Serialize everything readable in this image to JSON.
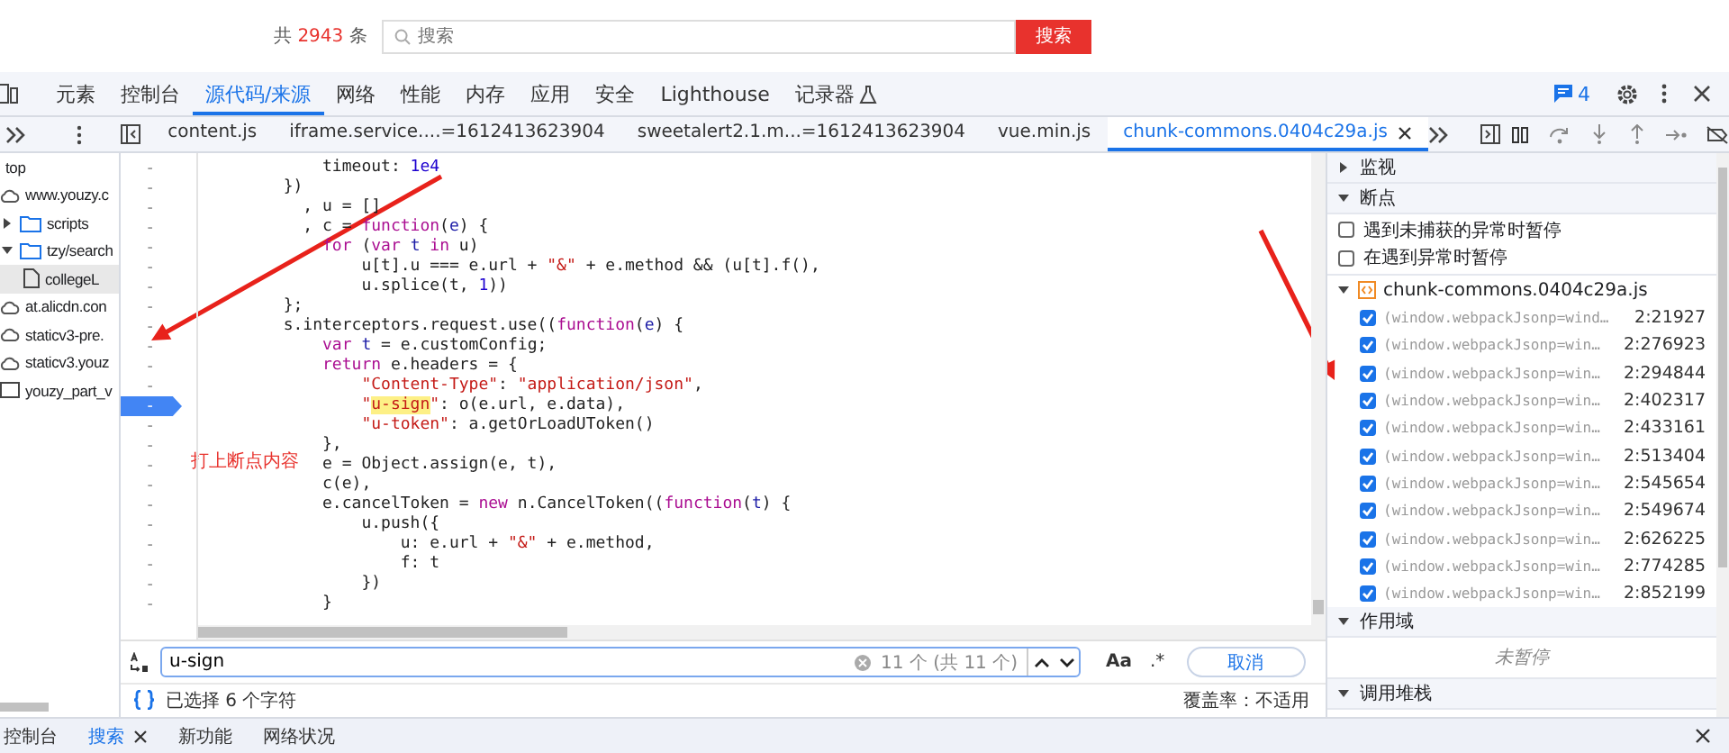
{
  "page": {
    "result_count": {
      "prefix": "共",
      "value": "2943",
      "suffix": "条"
    },
    "search": {
      "placeholder": "搜索"
    },
    "search_button": "搜索"
  },
  "devtools": {
    "tabs": [
      {
        "label": "元素",
        "selected": false,
        "experimental": false
      },
      {
        "label": "控制台",
        "selected": false,
        "experimental": false
      },
      {
        "label": "源代码/来源",
        "selected": true,
        "experimental": false
      },
      {
        "label": "网络",
        "selected": false,
        "experimental": false
      },
      {
        "label": "性能",
        "selected": false,
        "experimental": false
      },
      {
        "label": "内存",
        "selected": false,
        "experimental": false
      },
      {
        "label": "应用",
        "selected": false,
        "experimental": false
      },
      {
        "label": "安全",
        "selected": false,
        "experimental": false
      },
      {
        "label": "Lighthouse",
        "selected": false,
        "experimental": false
      },
      {
        "label": "记录器",
        "selected": false,
        "experimental": true
      }
    ],
    "issues": "4"
  },
  "sources": {
    "file_tabs": [
      {
        "label": "content.js",
        "selected": false
      },
      {
        "label": "iframe.service....=1612413623904",
        "selected": false
      },
      {
        "label": "sweetalert2.1.m...=1612413623904",
        "selected": false
      },
      {
        "label": "vue.min.js",
        "selected": false
      },
      {
        "label": "chunk-commons.0404c29a.js",
        "selected": true
      }
    ],
    "navigator": [
      {
        "label": "top",
        "selected": false,
        "children": [
          {
            "label": "www.youzy.c",
            "kind": "domain",
            "selected": false,
            "children": [
              {
                "label": "scripts",
                "kind": "folder",
                "expanded": false,
                "selected": false
              },
              {
                "label": "tzy/search",
                "kind": "folder",
                "expanded": true,
                "selected": false,
                "children": [
                  {
                    "label": "collegeL",
                    "kind": "file",
                    "selected": true
                  }
                ]
              }
            ]
          },
          {
            "label": "at.alicdn.con",
            "kind": "domain",
            "selected": false
          },
          {
            "label": "staticv3-pre.",
            "kind": "domain",
            "selected": false
          },
          {
            "label": "staticv3.youz",
            "kind": "domain",
            "selected": false
          },
          {
            "label": "youzy_part_v",
            "kind": "frame",
            "selected": false
          }
        ]
      }
    ],
    "code_lines": [
      {
        "gutter": "-",
        "breakpoint": false,
        "tokens": [
          {
            "text": "            timeout: ",
            "kind": "plain"
          },
          {
            "text": "1e4",
            "kind": "number"
          }
        ]
      },
      {
        "gutter": "-",
        "breakpoint": false,
        "tokens": [
          {
            "text": "        })",
            "kind": "plain"
          }
        ]
      },
      {
        "gutter": "-",
        "breakpoint": false,
        "tokens": [
          {
            "text": "          , u = []",
            "kind": "plain"
          }
        ]
      },
      {
        "gutter": "-",
        "breakpoint": false,
        "tokens": [
          {
            "text": "          , c = ",
            "kind": "plain"
          },
          {
            "text": "function",
            "kind": "keyword"
          },
          {
            "text": "(",
            "kind": "plain"
          },
          {
            "text": "e",
            "kind": "param"
          },
          {
            "text": ") {",
            "kind": "plain"
          }
        ]
      },
      {
        "gutter": "-",
        "breakpoint": false,
        "tokens": [
          {
            "text": "            for",
            "kind": "keyword"
          },
          {
            "text": " (",
            "kind": "plain"
          },
          {
            "text": "var ",
            "kind": "keyword"
          },
          {
            "text": "t ",
            "kind": "param"
          },
          {
            "text": "in",
            "kind": "keyword"
          },
          {
            "text": " u)",
            "kind": "plain"
          }
        ]
      },
      {
        "gutter": "-",
        "breakpoint": false,
        "tokens": [
          {
            "text": "                u[t].u === e.url + ",
            "kind": "plain"
          },
          {
            "text": "\"&\"",
            "kind": "string"
          },
          {
            "text": " + e.method && (u[t].f(),",
            "kind": "plain"
          }
        ]
      },
      {
        "gutter": "-",
        "breakpoint": false,
        "tokens": [
          {
            "text": "                u.splice(t, ",
            "kind": "plain"
          },
          {
            "text": "1",
            "kind": "number"
          },
          {
            "text": "))",
            "kind": "plain"
          }
        ]
      },
      {
        "gutter": "-",
        "breakpoint": false,
        "tokens": [
          {
            "text": "        };",
            "kind": "plain"
          }
        ]
      },
      {
        "gutter": "-",
        "breakpoint": false,
        "tokens": [
          {
            "text": "        s.interceptors.request.use((",
            "kind": "plain"
          },
          {
            "text": "function",
            "kind": "keyword"
          },
          {
            "text": "(",
            "kind": "plain"
          },
          {
            "text": "e",
            "kind": "param"
          },
          {
            "text": ") {",
            "kind": "plain"
          }
        ]
      },
      {
        "gutter": "-",
        "breakpoint": false,
        "tokens": [
          {
            "text": "            var ",
            "kind": "keyword"
          },
          {
            "text": "t",
            "kind": "param"
          },
          {
            "text": " = e.customConfig;",
            "kind": "plain"
          }
        ]
      },
      {
        "gutter": "-",
        "breakpoint": false,
        "tokens": [
          {
            "text": "            return",
            "kind": "keyword"
          },
          {
            "text": " e.headers = {",
            "kind": "plain"
          }
        ]
      },
      {
        "gutter": "-",
        "breakpoint": false,
        "tokens": [
          {
            "text": "                \"Content-Type\"",
            "kind": "string"
          },
          {
            "text": ": ",
            "kind": "plain"
          },
          {
            "text": "\"application/json\"",
            "kind": "string"
          },
          {
            "text": ",",
            "kind": "plain"
          }
        ]
      },
      {
        "gutter": "-",
        "breakpoint": true,
        "tokens": [
          {
            "text": "                \"",
            "kind": "string"
          },
          {
            "text": "u-sign",
            "kind": "match"
          },
          {
            "text": "\"",
            "kind": "string"
          },
          {
            "text": ": o(e.url, e.data),",
            "kind": "plain"
          }
        ]
      },
      {
        "gutter": "-",
        "breakpoint": false,
        "tokens": [
          {
            "text": "                \"u-token\"",
            "kind": "string"
          },
          {
            "text": ": a.getOrLoadUToken()",
            "kind": "plain"
          }
        ]
      },
      {
        "gutter": "-",
        "breakpoint": false,
        "tokens": [
          {
            "text": "            },",
            "kind": "plain"
          }
        ]
      },
      {
        "gutter": "-",
        "breakpoint": false,
        "tokens": [
          {
            "text": "            e = Object.assign(e, t),",
            "kind": "plain"
          }
        ]
      },
      {
        "gutter": "-",
        "breakpoint": false,
        "tokens": [
          {
            "text": "            c(e),",
            "kind": "plain"
          }
        ]
      },
      {
        "gutter": "-",
        "breakpoint": false,
        "tokens": [
          {
            "text": "            e.cancelToken = ",
            "kind": "plain"
          },
          {
            "text": "new",
            "kind": "keyword"
          },
          {
            "text": " n.CancelToken((",
            "kind": "plain"
          },
          {
            "text": "function",
            "kind": "keyword"
          },
          {
            "text": "(",
            "kind": "plain"
          },
          {
            "text": "t",
            "kind": "param"
          },
          {
            "text": ") {",
            "kind": "plain"
          }
        ]
      },
      {
        "gutter": "-",
        "breakpoint": false,
        "tokens": [
          {
            "text": "                u.push({",
            "kind": "plain"
          }
        ]
      },
      {
        "gutter": "-",
        "breakpoint": false,
        "tokens": [
          {
            "text": "                    u: e.url + ",
            "kind": "plain"
          },
          {
            "text": "\"&\"",
            "kind": "string"
          },
          {
            "text": " + e.method,",
            "kind": "plain"
          }
        ]
      },
      {
        "gutter": "-",
        "breakpoint": false,
        "tokens": [
          {
            "text": "                    f: t",
            "kind": "plain"
          }
        ]
      },
      {
        "gutter": "-",
        "breakpoint": false,
        "tokens": [
          {
            "text": "                })",
            "kind": "plain"
          }
        ]
      },
      {
        "gutter": "-",
        "breakpoint": false,
        "tokens": [
          {
            "text": "            }",
            "kind": "plain"
          }
        ]
      }
    ],
    "annotation": "打上断点内容",
    "search": {
      "value": "u-sign",
      "matches": "11 个 (共 11 个)",
      "match_case": "Aa",
      "regex": ".*",
      "cancel": "取消"
    },
    "status": {
      "selection": "已选择 6 个字符",
      "coverage": "覆盖率：不适用"
    }
  },
  "right_pane": {
    "watch": {
      "title": "监视",
      "expanded": false
    },
    "breakpoints": {
      "title": "断点",
      "expanded": true,
      "options": [
        {
          "label": "遇到未捕获的异常时暂停",
          "checked": false
        },
        {
          "label": "在遇到异常时暂停",
          "checked": false
        }
      ],
      "file": {
        "name": "chunk-commons.0404c29a.js",
        "expanded": true,
        "items": [
          {
            "text": "(window.webpackJsonp=wind…",
            "location": "2:21927",
            "checked": true
          },
          {
            "text": "(window.webpackJsonp=win…",
            "location": "2:276923",
            "checked": true
          },
          {
            "text": "(window.webpackJsonp=win…",
            "location": "2:294844",
            "checked": true
          },
          {
            "text": "(window.webpackJsonp=win…",
            "location": "2:402317",
            "checked": true
          },
          {
            "text": "(window.webpackJsonp=win…",
            "location": "2:433161",
            "checked": true
          },
          {
            "text": "(window.webpackJsonp=win…",
            "location": "2:513404",
            "checked": true
          },
          {
            "text": "(window.webpackJsonp=win…",
            "location": "2:545654",
            "checked": true
          },
          {
            "text": "(window.webpackJsonp=win…",
            "location": "2:549674",
            "checked": true
          },
          {
            "text": "(window.webpackJsonp=win…",
            "location": "2:626225",
            "checked": true
          },
          {
            "text": "(window.webpackJsonp=win…",
            "location": "2:774285",
            "checked": true
          },
          {
            "text": "(window.webpackJsonp=win…",
            "location": "2:852199",
            "checked": true
          }
        ]
      }
    },
    "scope": {
      "title": "作用域",
      "expanded": true,
      "message": "未暂停"
    },
    "call_stack": {
      "title": "调用堆栈",
      "expanded": true
    }
  },
  "drawer": {
    "tabs": [
      {
        "label": "控制台",
        "selected": false,
        "closable": false
      },
      {
        "label": "搜索",
        "selected": true,
        "closable": true
      },
      {
        "label": "新功能",
        "selected": false,
        "closable": false
      },
      {
        "label": "网络状况",
        "selected": false,
        "closable": false
      }
    ]
  }
}
